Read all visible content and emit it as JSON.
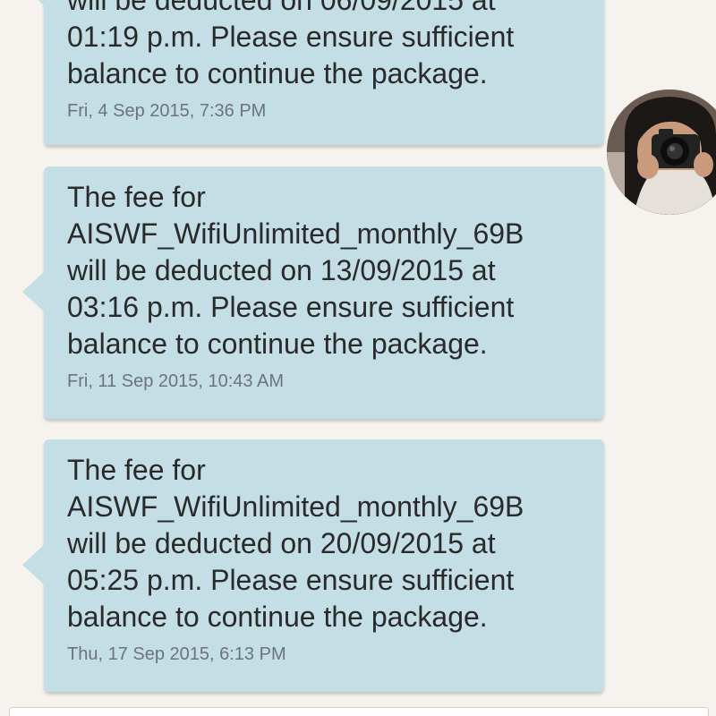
{
  "messages": [
    {
      "text": "will be deducted on 06/09/2015 at\n01:19 p.m. Please ensure sufficient\nbalance to continue the package.",
      "time": "Fri, 4 Sep 2015, 7:36 PM"
    },
    {
      "text": "The fee for\nAISWF_WifiUnlimited_monthly_69B\nwill be deducted on 13/09/2015 at\n03:16 p.m. Please ensure sufficient\nbalance to continue the package.",
      "time": "Fri, 11 Sep 2015, 10:43 AM"
    },
    {
      "text": "The fee for\nAISWF_WifiUnlimited_monthly_69B\nwill be deducted on 20/09/2015 at\n05:25 p.m. Please ensure sufficient\nbalance to continue the package.",
      "time": "Thu, 17 Sep 2015, 6:13 PM"
    }
  ],
  "avatar": {
    "icon": "user-avatar-photo"
  },
  "colors": {
    "background": "#f6f2ee",
    "bubble": "#c4dee6",
    "text": "#2a2a2a",
    "timestamp": "#6c7478"
  }
}
